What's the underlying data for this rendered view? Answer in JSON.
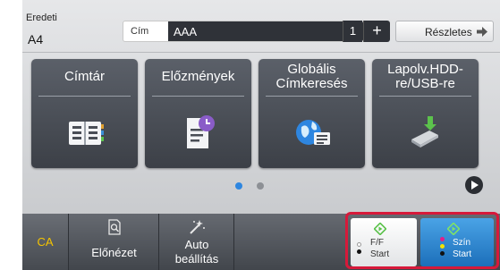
{
  "original": {
    "label": "Eredeti",
    "value": "A4"
  },
  "title_field": {
    "label": "Cím",
    "value": "AAA"
  },
  "copies": "1",
  "plus_label": "+",
  "details_label": "Részletes",
  "tiles": [
    {
      "label": "Címtár",
      "icon": "address-book-icon"
    },
    {
      "label": "Előzmények",
      "icon": "history-document-icon"
    },
    {
      "label": "Globális Címkeresés",
      "icon": "global-search-icon"
    },
    {
      "label": "Lapolv.HDD-re/USB-re",
      "icon": "usb-storage-icon"
    }
  ],
  "pager": {
    "pages": 2,
    "current": 1
  },
  "bottom": {
    "ca": "CA",
    "preview": "Előnézet",
    "auto_line1": "Auto",
    "auto_line2": "beállítás",
    "bw_line1": "F/F",
    "bw_line2": "Start",
    "color_line1": "Szín",
    "color_line2": "Start"
  },
  "colors": {
    "accent_blue": "#2e86e0",
    "start_highlight": "#d7193a",
    "ca_text": "#f5c400",
    "start_green": "#5cc24c"
  }
}
